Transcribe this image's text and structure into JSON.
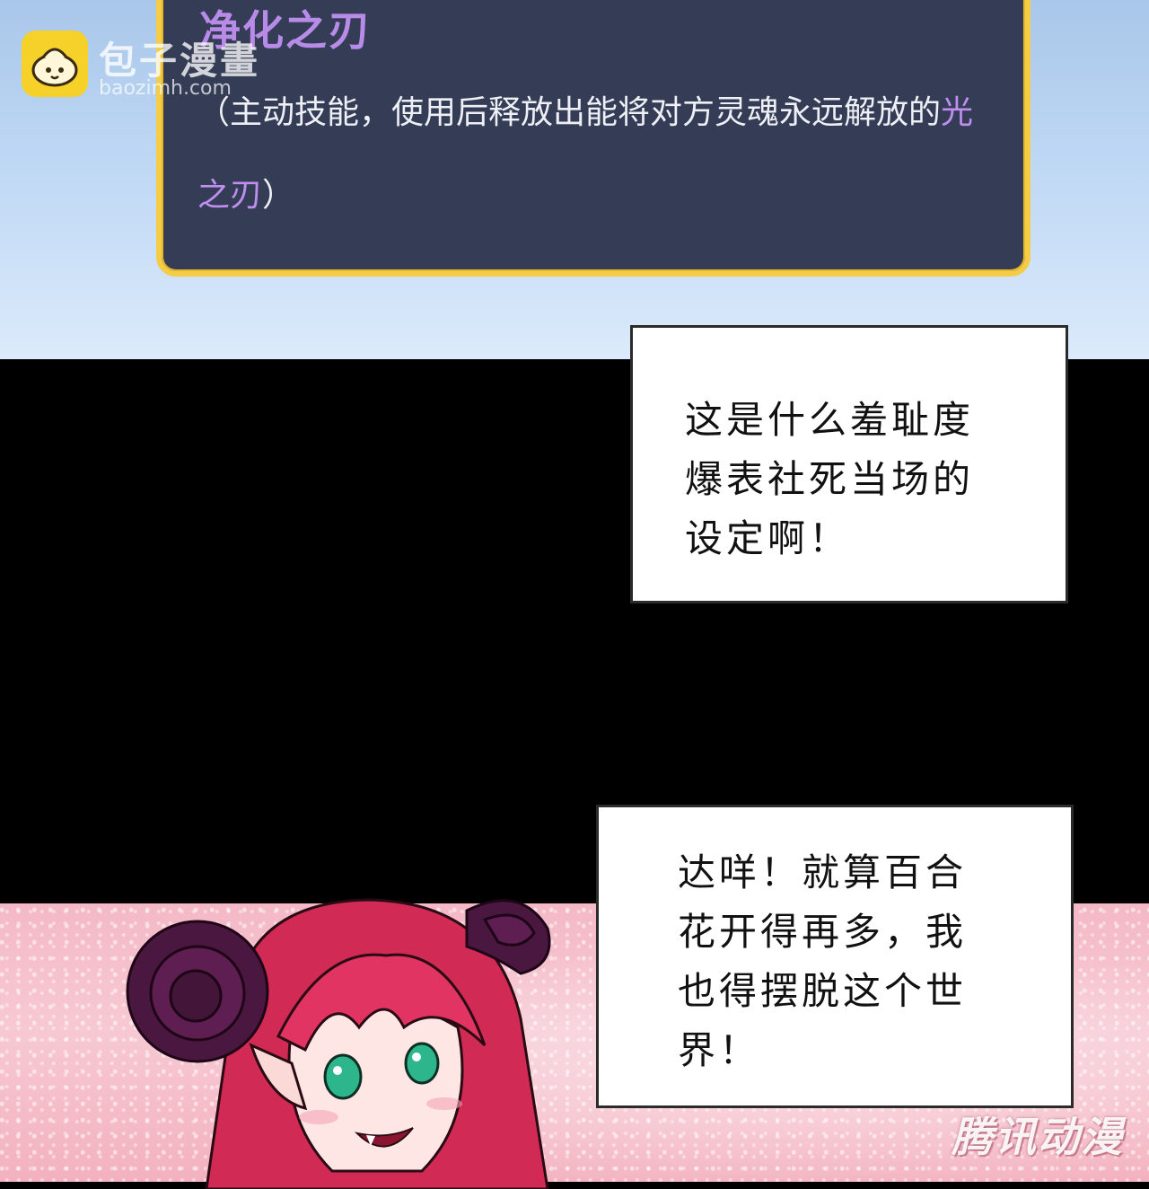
{
  "watermark": {
    "name": "包子漫畫",
    "domain": "baozimh.com"
  },
  "skill_card": {
    "title": "净化之刃",
    "desc_prefix": "（主动技能，使用后释放出能将对方灵魂永远解放的",
    "desc_highlight": "光之刃",
    "desc_suffix": "）",
    "title_color": "#b98be8",
    "border_color": "#f5cc45",
    "bg_color": "#343d55"
  },
  "speech_1": {
    "lines": [
      "这是什么羞耻度",
      "爆表社死当场的",
      "设定啊！"
    ]
  },
  "speech_2": {
    "lines": [
      "达咩！就算百合",
      "花开得再多，我",
      "也得摆脱这个世",
      "界！"
    ]
  },
  "bottom_watermark": "腾讯动漫"
}
